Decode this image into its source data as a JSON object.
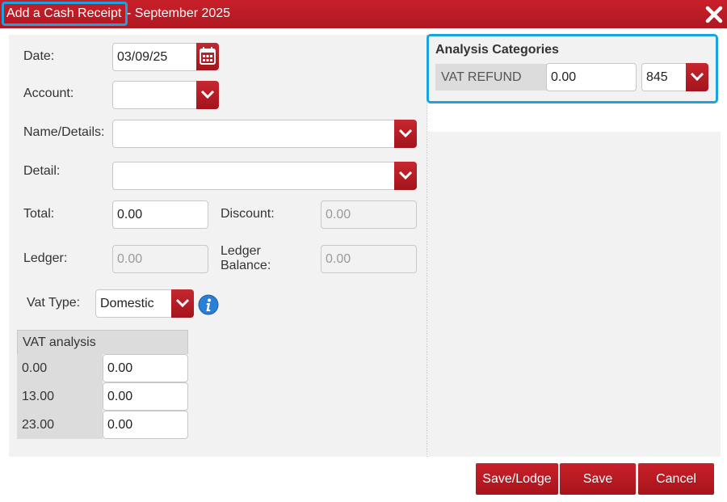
{
  "dialog": {
    "title_main": "Add a Cash Receipt",
    "title_rest": " - September 2025"
  },
  "form": {
    "date_label": "Date:",
    "date_value": "03/09/25",
    "account_label": "Account:",
    "account_value": "",
    "name_label": "Name/Details:",
    "name_value": "",
    "detail_label": "Detail:",
    "detail_value": "",
    "total_label": "Total:",
    "total_value": "0.00",
    "discount_label": "Discount:",
    "discount_value": "0.00",
    "ledger_label": "Ledger:",
    "ledger_value": "0.00",
    "ledger_balance_label_1": "Ledger",
    "ledger_balance_label_2": "Balance:",
    "ledger_balance_value": "0.00",
    "vat_type_label": "Vat Type:",
    "vat_type_value": "Domestic"
  },
  "vat_analysis": {
    "header": "VAT analysis",
    "rows": [
      {
        "rate": "0.00",
        "value": "0.00"
      },
      {
        "rate": "13.00",
        "value": "0.00"
      },
      {
        "rate": "23.00",
        "value": "0.00"
      }
    ]
  },
  "analysis": {
    "title": "Analysis Categories",
    "category": "VAT REFUND",
    "amount": "0.00",
    "code": "845"
  },
  "buttons": {
    "save_lodge": "Save/Lodge",
    "save": "Save",
    "cancel": "Cancel"
  },
  "colors": {
    "brand_red": "#b81c24",
    "highlight_blue": "#1aa3e0",
    "info_blue": "#2a7fd4"
  }
}
